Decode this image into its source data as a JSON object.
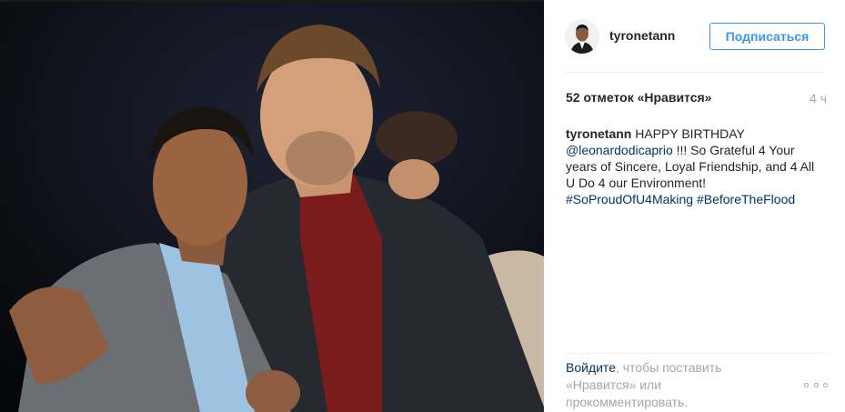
{
  "post": {
    "photo_alt": "photo",
    "username": "tyronetann",
    "follow_label": "Подписаться",
    "likes": "52 отметок «Нравится»",
    "time": "4 ч",
    "caption": {
      "author": "tyronetann",
      "text_1": " HAPPY BIRTHDAY ",
      "mention": "@leonardodicaprio",
      "text_2": " !!! So Grateful 4 Your years of Sincere, Loyal Friendship, and 4 All U Do 4 our Environment! ",
      "hashtag_1": "#SoProudOfU4Making",
      "hashtag_2": "#BeforeTheFlood"
    },
    "footer": {
      "login_link": "Войдите",
      "text": ", чтобы поставить «Нравится» или прокомментировать."
    },
    "more_icon": "more-options-icon"
  },
  "colors": {
    "accent": "#3897f0",
    "link": "#003569",
    "muted": "#a5a7aa",
    "text": "#262626"
  }
}
